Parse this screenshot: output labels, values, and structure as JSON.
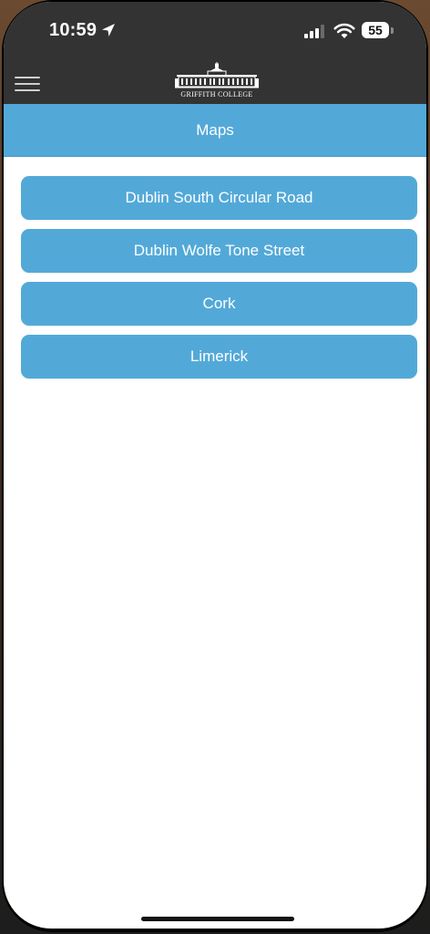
{
  "status_bar": {
    "time": "10:59",
    "battery": "55",
    "icons": [
      "location-arrow-icon",
      "cellular-signal-icon",
      "wifi-icon",
      "battery-icon"
    ]
  },
  "header": {
    "menu_icon": "hamburger-menu-icon",
    "logo_text": "GRIFFITH COLLEGE",
    "background": "#333333"
  },
  "title_bar": {
    "title": "Maps",
    "background": "#52a9d8"
  },
  "maps": {
    "items": [
      {
        "label": "Dublin South Circular Road"
      },
      {
        "label": "Dublin Wolfe Tone Street"
      },
      {
        "label": "Cork"
      },
      {
        "label": "Limerick"
      }
    ],
    "button_color": "#52a9d8",
    "text_color": "#ffffff"
  }
}
